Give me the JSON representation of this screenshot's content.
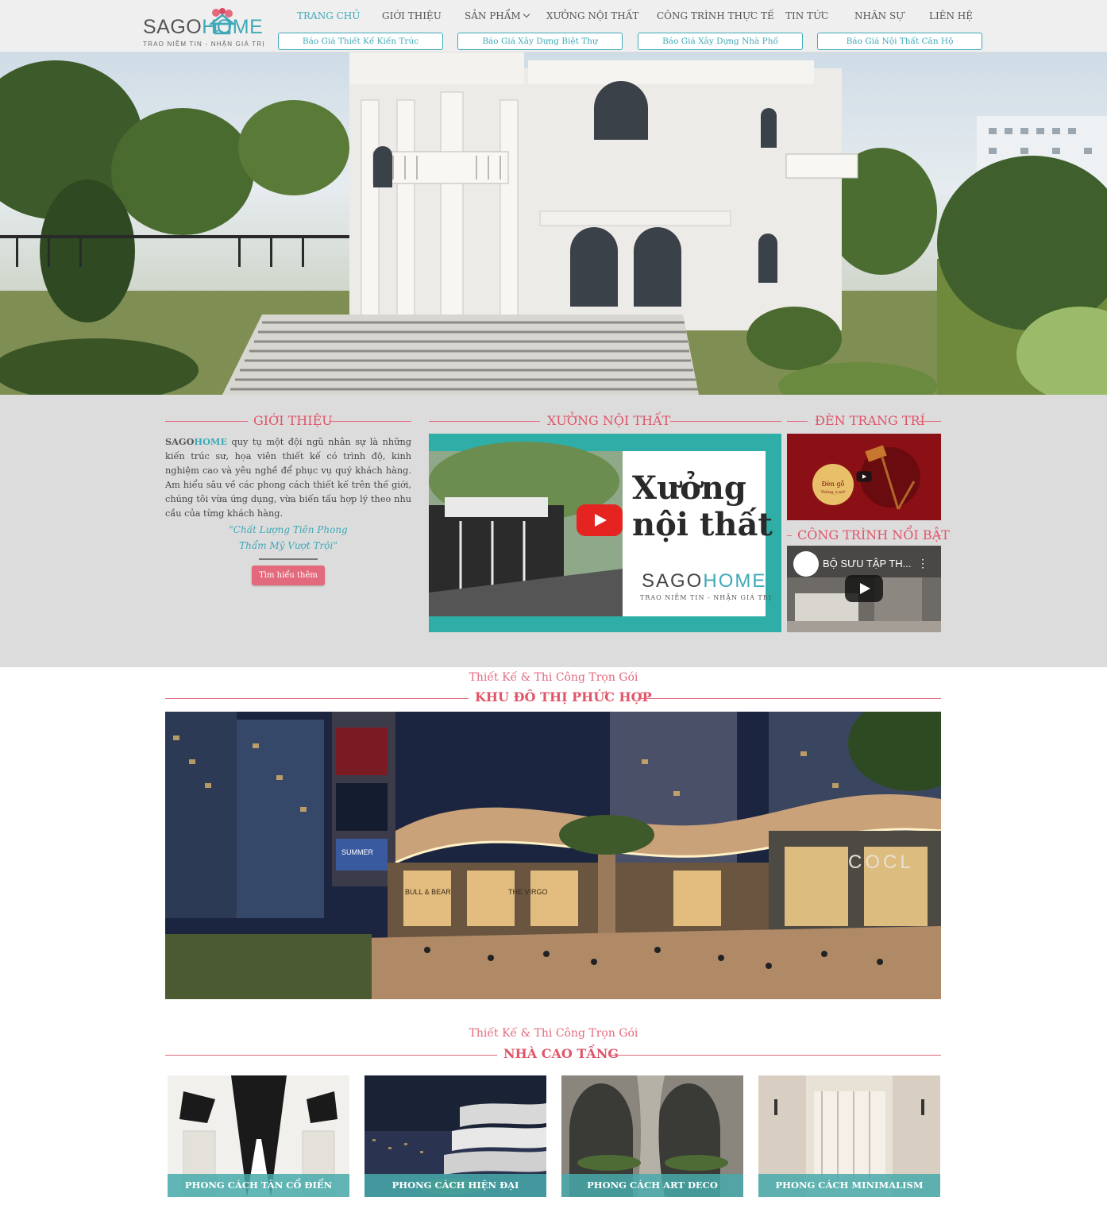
{
  "brand": {
    "name_part1": "SAGO",
    "name_part2": "HOME",
    "tagline": "TRAO NIỀM TIN - NHẬN GIÁ TRỊ"
  },
  "nav": {
    "items": [
      {
        "label": "TRANG CHỦ",
        "active": true
      },
      {
        "label": "GIỚI THIỆU"
      },
      {
        "label": "SẢN PHẨM",
        "has_dropdown": true
      },
      {
        "label": "XƯỞNG NỘI THẤT"
      },
      {
        "label": "CÔNG TRÌNH THỰC TẾ"
      },
      {
        "label": "TIN TỨC"
      },
      {
        "label": "NHÂN SỰ"
      },
      {
        "label": "LIÊN HỆ"
      }
    ],
    "quote_buttons": [
      "Báo Giá Thiết Kế Kiến Trúc",
      "Báo Giá Xây Dựng Biệt Thự",
      "Báo Giá Xây Dựng Nhà Phố",
      "Báo Giá Nội Thất Căn Hộ"
    ]
  },
  "intro": {
    "heading": "GIỚI THIỆU",
    "brand_a": "SAGO",
    "brand_b": "HOME",
    "body": " quy tụ một đội ngũ nhân sự là những kiến trúc sư, họa viên thiết kế có trình độ, kinh nghiệm cao và yêu nghề để phục vụ quý khách hàng. Am hiểu sâu về các phong cách thiết kế trên thế giới, chúng tôi vừa ứng dụng, vừa biến tấu hợp lý theo nhu cầu của từng khách hàng.",
    "slogan_line1": "\"Chất Lượng Tiên Phong",
    "slogan_line2": "Thẩm Mỹ Vượt Trội\"",
    "button": "Tìm hiểu thêm"
  },
  "workshop": {
    "heading": "XƯỞNG NỘI THẤT",
    "video_title_line1": "Xưởng",
    "video_title_line2": "nội thất",
    "video_brand_a": "SAGO",
    "video_brand_b": "HOME",
    "video_tagline": "TRAO NIỀM TIN - NHẬN GIÁ TRỊ"
  },
  "lamps": {
    "heading": "ĐÈN TRANG TRÍ",
    "badge_line1": "Đèn gỗ",
    "badge_line2": "Thông_z,nàº"
  },
  "featured": {
    "heading": "CÔNG TRÌNH NỔI BẬT",
    "video_title": "BỘ SƯU TẬP TH..."
  },
  "urban_section": {
    "kicker": "Thiết Kế & Thi Công Trọn Gói",
    "title": "KHU ĐÔ THỊ PHỨC HỢP",
    "signs": {
      "mall": "COCL",
      "store1": "BULL & BEAR",
      "store2": "THE VIRGO",
      "billboard": "SUMMER"
    }
  },
  "highrise_section": {
    "kicker": "Thiết Kế & Thi Công Trọn Gói",
    "title": "NHÀ CAO TẦNG",
    "cards": [
      "PHONG CÁCH TÂN CỔ ĐIỂN",
      "PHONG CÁCH HIỆN ĐẠI",
      "PHONG CÁCH ART DECO",
      "PHONG CÁCH MINIMALISM"
    ]
  },
  "colors": {
    "accent_teal": "#3fa9b8",
    "accent_pink": "#e36a7c",
    "header_bg": "#efefef",
    "band_bg": "#dcdcdc"
  }
}
